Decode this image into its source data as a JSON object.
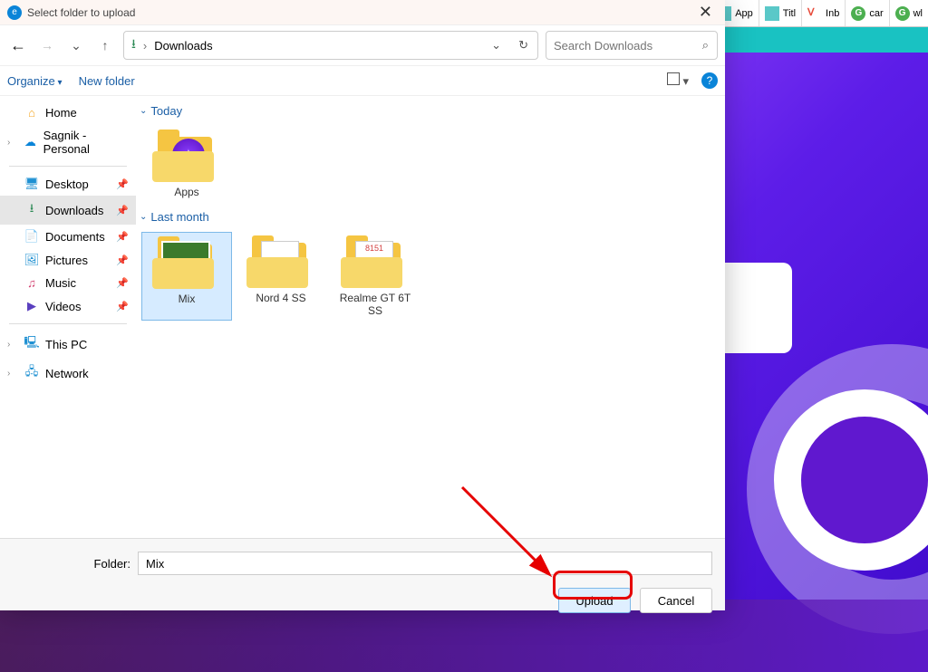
{
  "browser_tabs": [
    {
      "icon": "box",
      "label": "App"
    },
    {
      "icon": "box",
      "label": "Titl"
    },
    {
      "icon": "v",
      "label": "Inb"
    },
    {
      "icon": "g",
      "label": "car"
    },
    {
      "icon": "g",
      "label": "wl"
    }
  ],
  "dialog": {
    "title": "Select folder to upload",
    "path_current": "Downloads",
    "search_placeholder": "Search Downloads",
    "toolbar": {
      "organize": "Organize",
      "new_folder": "New folder"
    },
    "sidebar": {
      "home": "Home",
      "personal": "Sagnik - Personal",
      "quick": [
        {
          "name": "Desktop",
          "icon": "🖥",
          "color": "#1e90d2"
        },
        {
          "name": "Downloads",
          "icon": "⭳",
          "color": "#2e8b57",
          "selected": true
        },
        {
          "name": "Documents",
          "icon": "📄",
          "color": "#1e90d2"
        },
        {
          "name": "Pictures",
          "icon": "🖼",
          "color": "#1e90d2"
        },
        {
          "name": "Music",
          "icon": "♫",
          "color": "#d23f6f"
        },
        {
          "name": "Videos",
          "icon": "▶",
          "color": "#5a3fbf"
        }
      ],
      "this_pc": "This PC",
      "network": "Network"
    },
    "groups": [
      {
        "heading": "Today",
        "items": [
          {
            "name": "Apps",
            "variant": "astro"
          }
        ]
      },
      {
        "heading": "Last month",
        "items": [
          {
            "name": "Mix",
            "variant": "photo",
            "selected": true
          },
          {
            "name": "Nord 4 SS",
            "variant": "doc"
          },
          {
            "name": "Realme GT 6T SS",
            "variant": "doc",
            "doc_text": "8151"
          }
        ]
      }
    ],
    "footer": {
      "folder_label": "Folder:",
      "folder_value": "Mix",
      "upload": "Upload",
      "cancel": "Cancel"
    }
  }
}
